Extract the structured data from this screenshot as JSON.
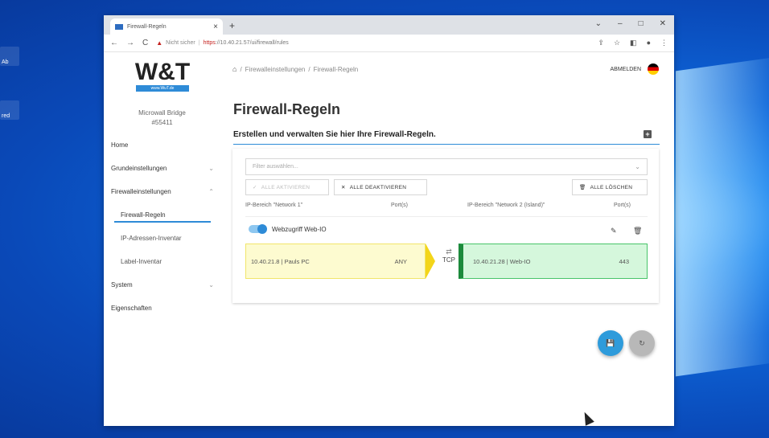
{
  "desktop": {
    "icon_labels": [
      "Ab",
      "red"
    ]
  },
  "browser": {
    "tab_title": "Firewall-Regeln",
    "tab_close": "×",
    "new_tab": "+",
    "window_controls": [
      "⌄",
      "–",
      "□",
      "✕"
    ],
    "nav_back": "←",
    "nav_forward": "→",
    "nav_reload": "C",
    "not_secure": "Nicht sicher",
    "url_https": "https",
    "url_rest": "://10.40.21.57/ui/firewall/rules",
    "right_icons": [
      "⇪",
      "☆",
      "◧",
      "●",
      "⋮"
    ]
  },
  "sidebar": {
    "logo_text": "W&T",
    "logo_sub": "www.WuT.de",
    "device_name": "Microwall Bridge",
    "device_id": "#55411",
    "items": [
      {
        "label": "Home",
        "chevron": ""
      },
      {
        "label": "Grundeinstellungen",
        "chevron": "⌄"
      },
      {
        "label": "Firewalleinstellungen",
        "chevron": "⌃"
      },
      {
        "label": "Firewall-Regeln",
        "chevron": ""
      },
      {
        "label": "IP-Adressen-Inventar",
        "chevron": ""
      },
      {
        "label": "Label-Inventar",
        "chevron": ""
      },
      {
        "label": "System",
        "chevron": "⌄"
      },
      {
        "label": "Eigenschaften",
        "chevron": ""
      }
    ]
  },
  "header": {
    "home_icon": "⌂",
    "breadcrumb_sep": "/",
    "breadcrumb": [
      "Firewalleinstellungen",
      "Firewall-Regeln"
    ],
    "logout": "ABMELDEN"
  },
  "main": {
    "title": "Firewall-Regeln",
    "subtitle": "Erstellen und verwalten Sie hier Ihre Firewall-Regeln.",
    "add_icon": "+",
    "filter_placeholder": "Filter auswählen...",
    "filter_chevron": "⌄",
    "btn_activate_all": "ALLE AKTIVIEREN",
    "btn_activate_icon": "✓",
    "btn_deactivate_all": "ALLE DEAKTIVIEREN",
    "btn_deactivate_icon": "✕",
    "btn_delete_all": "ALLE LÖSCHEN",
    "btn_delete_icon": "🗑",
    "columns": [
      "IP-Bereich \"Network 1\"",
      "Port(s)",
      "IP-Bereich \"Network 2 (Island)\"",
      "Port(s)"
    ],
    "rule": {
      "name": "Webzugriff Web-IO",
      "enabled": true,
      "edit_icon": "✎",
      "delete_icon": "🗑",
      "src_ip": "10.40.21.8 | Pauls PC",
      "src_port": "ANY",
      "protocol": "TCP",
      "protocol_icon": "⇄",
      "dst_ip": "10.40.21.28 | Web-IO",
      "dst_port": "443"
    },
    "fab_save_icon": "💾",
    "fab_reset_icon": "↻"
  }
}
